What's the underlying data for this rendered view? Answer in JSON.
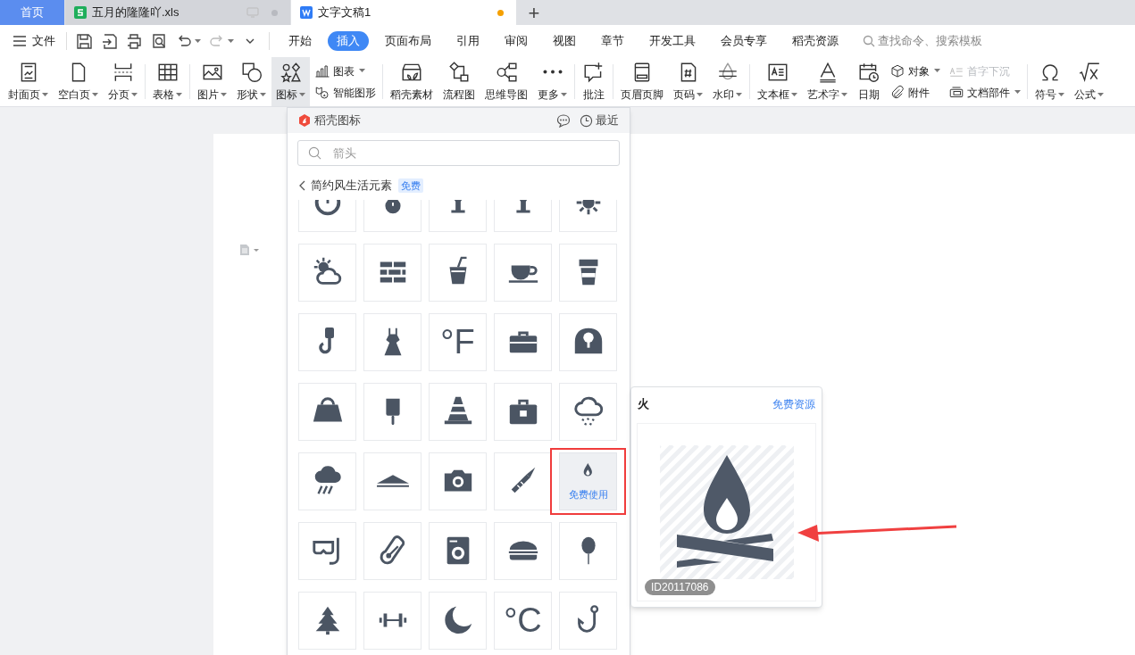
{
  "tabs": [
    {
      "label": "首页",
      "kind": "home",
      "selected": false
    },
    {
      "label": "五月的隆隆吖.xls",
      "kind": "sheet",
      "selected": false,
      "modified": false
    },
    {
      "label": "文字文稿1",
      "kind": "doc",
      "selected": true,
      "modified": true
    }
  ],
  "new_tab": "+",
  "file_menu": "文件",
  "menu_tabs": [
    {
      "label": "开始",
      "selected": false
    },
    {
      "label": "插入",
      "selected": true
    },
    {
      "label": "页面布局",
      "selected": false
    },
    {
      "label": "引用",
      "selected": false
    },
    {
      "label": "审阅",
      "selected": false
    },
    {
      "label": "视图",
      "selected": false
    },
    {
      "label": "章节",
      "selected": false
    },
    {
      "label": "开发工具",
      "selected": false
    },
    {
      "label": "会员专享",
      "selected": false
    },
    {
      "label": "稻壳资源",
      "selected": false
    }
  ],
  "command_search": {
    "placeholder": "查找命令、搜索模板"
  },
  "ribbon": [
    [
      {
        "kind": "large",
        "label": "封面页",
        "dropdown": true,
        "expanded": false
      },
      {
        "kind": "large",
        "label": "空白页",
        "dropdown": true,
        "expanded": false
      },
      {
        "kind": "large",
        "label": "分页",
        "dropdown": true,
        "expanded": false
      }
    ],
    [
      {
        "kind": "large",
        "label": "表格",
        "dropdown": true,
        "expanded": false
      }
    ],
    [
      {
        "kind": "large",
        "label": "图片",
        "dropdown": true,
        "expanded": false
      },
      {
        "kind": "large",
        "label": "形状",
        "dropdown": true,
        "expanded": false
      },
      {
        "kind": "large",
        "label": "图标",
        "dropdown": true,
        "expanded": true
      },
      {
        "kind": "stack",
        "items": [
          {
            "label": "图表",
            "dropdown": true,
            "disabled": false
          },
          {
            "label": "智能图形",
            "dropdown": false,
            "disabled": false
          }
        ]
      }
    ],
    [
      {
        "kind": "large",
        "label": "稻壳素材",
        "dropdown": false,
        "expanded": false
      },
      {
        "kind": "large",
        "label": "流程图",
        "dropdown": false,
        "expanded": false
      },
      {
        "kind": "large",
        "label": "思维导图",
        "dropdown": false,
        "expanded": false
      },
      {
        "kind": "large",
        "label": "更多",
        "dropdown": true,
        "expanded": false
      }
    ],
    [
      {
        "kind": "large",
        "label": "批注",
        "dropdown": false,
        "expanded": false
      }
    ],
    [
      {
        "kind": "large",
        "label": "页眉页脚",
        "dropdown": false,
        "expanded": false
      },
      {
        "kind": "large",
        "label": "页码",
        "dropdown": true,
        "expanded": false
      },
      {
        "kind": "large",
        "label": "水印",
        "dropdown": true,
        "expanded": false
      }
    ],
    [
      {
        "kind": "large",
        "label": "文本框",
        "dropdown": true,
        "expanded": false
      },
      {
        "kind": "large",
        "label": "艺术字",
        "dropdown": true,
        "expanded": false
      },
      {
        "kind": "large",
        "label": "日期",
        "dropdown": false,
        "expanded": false
      },
      {
        "kind": "stack",
        "items": [
          {
            "label": "对象",
            "dropdown": true,
            "disabled": false
          },
          {
            "label": "附件",
            "dropdown": false,
            "disabled": false
          }
        ]
      },
      {
        "kind": "stack",
        "items": [
          {
            "label": "首字下沉",
            "dropdown": false,
            "disabled": true
          },
          {
            "label": "文档部件",
            "dropdown": true,
            "disabled": false
          }
        ]
      }
    ],
    [
      {
        "kind": "large",
        "label": "符号",
        "dropdown": true,
        "expanded": false
      },
      {
        "kind": "large",
        "label": "公式",
        "dropdown": true,
        "expanded": false
      }
    ]
  ],
  "icon_panel": {
    "title": "稻壳图标",
    "recent": "最近",
    "search": {
      "placeholder": "箭头"
    },
    "category": "简约风生活元素",
    "category_badge": "免费",
    "tiles": [
      {
        "kind": "clock",
        "selected": false
      },
      {
        "kind": "stopwatch",
        "selected": false
      },
      {
        "kind": "goblet",
        "selected": false
      },
      {
        "kind": "goblet",
        "selected": false
      },
      {
        "kind": "sun",
        "selected": false
      },
      {
        "kind": "weather",
        "selected": false
      },
      {
        "kind": "bricks",
        "selected": false
      },
      {
        "kind": "drink",
        "selected": false
      },
      {
        "kind": "cup",
        "selected": false
      },
      {
        "kind": "coffee",
        "selected": false
      },
      {
        "kind": "crane-hook",
        "selected": false
      },
      {
        "kind": "dress",
        "selected": false
      },
      {
        "kind": "glyph",
        "glyph": "°F",
        "selected": false
      },
      {
        "kind": "toolbox",
        "selected": false
      },
      {
        "kind": "helmet",
        "selected": false
      },
      {
        "kind": "handbag",
        "selected": false
      },
      {
        "kind": "popsicle",
        "selected": false
      },
      {
        "kind": "cone",
        "selected": false
      },
      {
        "kind": "briefcase",
        "selected": false
      },
      {
        "kind": "rain-cloud",
        "selected": false
      },
      {
        "kind": "storm",
        "selected": false
      },
      {
        "kind": "tent",
        "selected": false
      },
      {
        "kind": "camera",
        "selected": false
      },
      {
        "kind": "rocket",
        "selected": false
      },
      {
        "kind": "fire",
        "selected": true,
        "action": "免费使用"
      },
      {
        "kind": "goggles",
        "selected": false
      },
      {
        "kind": "thermometer",
        "selected": false
      },
      {
        "kind": "washer",
        "selected": false
      },
      {
        "kind": "burger",
        "selected": false
      },
      {
        "kind": "balloon",
        "selected": false
      },
      {
        "kind": "tree",
        "selected": false
      },
      {
        "kind": "dumbbell",
        "selected": false
      },
      {
        "kind": "moon",
        "selected": false
      },
      {
        "kind": "glyph",
        "glyph": "°C",
        "selected": false
      },
      {
        "kind": "hook",
        "selected": false
      }
    ]
  },
  "preview": {
    "title": "火",
    "link": "免费资源",
    "id": "ID20117086"
  }
}
